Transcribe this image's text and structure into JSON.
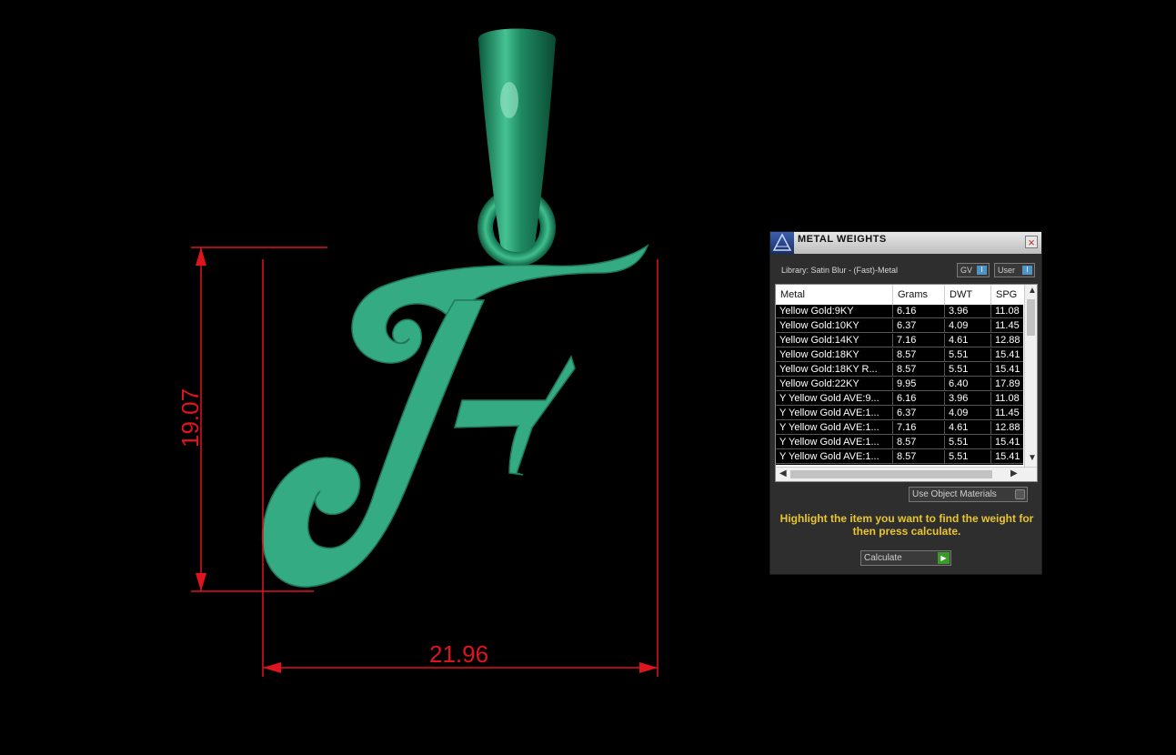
{
  "viewport": {
    "background": "#000000",
    "model_color": "#35ab83",
    "dimension_color": "#e0141c",
    "dimensions": {
      "height": "19.07",
      "width": "21.96"
    }
  },
  "panel": {
    "title": "METAL WEIGHTS",
    "close_glyph": "×",
    "library": "Library: Satin Blur - (Fast)-Metal",
    "gv_label": "GV",
    "user_label": "User",
    "toggle_glyph": "I",
    "columns": [
      "Metal",
      "Grams",
      "DWT",
      "SPG"
    ],
    "rows": [
      [
        "Yellow Gold:9KY",
        "6.16",
        "3.96",
        "11.08"
      ],
      [
        "Yellow Gold:10KY",
        "6.37",
        "4.09",
        "11.45"
      ],
      [
        "Yellow Gold:14KY",
        "7.16",
        "4.61",
        "12.88"
      ],
      [
        "Yellow Gold:18KY",
        "8.57",
        "5.51",
        "15.41"
      ],
      [
        "Yellow Gold:18KY R...",
        "8.57",
        "5.51",
        "15.41"
      ],
      [
        "Yellow Gold:22KY",
        "9.95",
        "6.40",
        "17.89"
      ],
      [
        "Y Yellow Gold AVE:9...",
        "6.16",
        "3.96",
        "11.08"
      ],
      [
        "Y Yellow Gold AVE:1...",
        "6.37",
        "4.09",
        "11.45"
      ],
      [
        "Y Yellow Gold AVE:1...",
        "7.16",
        "4.61",
        "12.88"
      ],
      [
        "Y Yellow Gold AVE:1...",
        "8.57",
        "5.51",
        "15.41"
      ],
      [
        "Y Yellow Gold AVE:1...",
        "8.57",
        "5.51",
        "15.41"
      ]
    ],
    "use_object_materials": "Use Object Materials",
    "hint": "Highlight the item you want to find the weight for then press calculate.",
    "calculate": "Calculate",
    "calculate_glyph": "▶",
    "accent": "#e8c531"
  }
}
